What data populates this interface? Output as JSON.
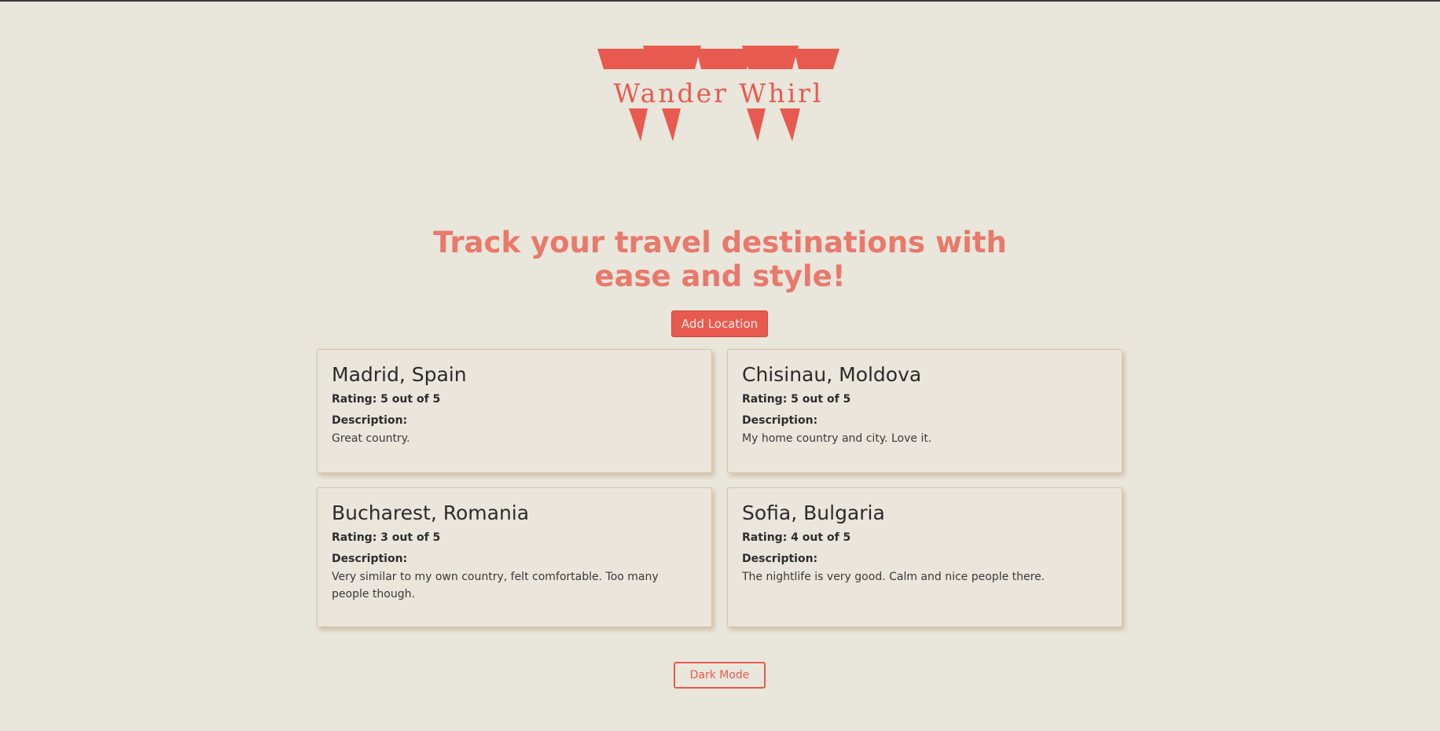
{
  "brand": {
    "name": "Wander Whirl",
    "color": "#e85a4f"
  },
  "hero": {
    "title": "Track your travel destinations with ease and style!"
  },
  "actions": {
    "add_label": "Add Location",
    "dark_mode_label": "Dark Mode"
  },
  "locations": [
    {
      "title": "Madrid, Spain",
      "rating": "Rating: 5 out of 5",
      "description_label": "Description:",
      "description": "Great country."
    },
    {
      "title": "Chisinau, Moldova",
      "rating": "Rating: 5 out of 5",
      "description_label": "Description:",
      "description": "My home country and city. Love it."
    },
    {
      "title": "Bucharest, Romania",
      "rating": "Rating: 3 out of 5",
      "description_label": "Description:",
      "description": "Very similar to my own country, felt comfortable. Too many people though."
    },
    {
      "title": "Sofia, Bulgaria",
      "rating": "Rating: 4 out of 5",
      "description_label": "Description:",
      "description": "The nightlife is very good. Calm and nice people there."
    }
  ],
  "colors": {
    "background": "#e9e6dc",
    "accent": "#e85a4f",
    "heading": "#e8796b",
    "card_border": "#d8c3a3"
  }
}
